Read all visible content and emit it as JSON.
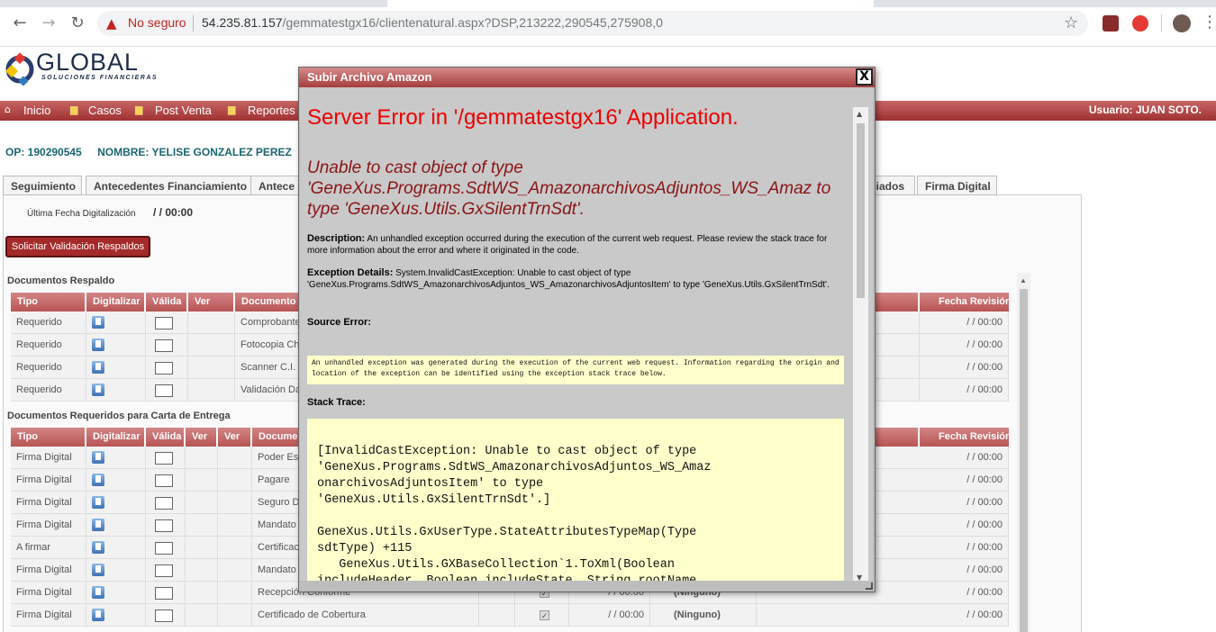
{
  "browser": {
    "security_label": "No seguro",
    "url_host": "54.235.81.157",
    "url_path": "/gemmatestgx16/clientenatural.aspx?DSP,213222,290545,275908,0"
  },
  "logo": {
    "name": "GLOBAL",
    "sub": "SOLUCIONES FINANCIERAS"
  },
  "nav": {
    "items": [
      "Inicio",
      "Casos",
      "Post Venta",
      "Reportes"
    ],
    "user_label": "Usuario:  JUAN SOTO."
  },
  "header": {
    "op": "OP: 190290545",
    "name": "NOMBRE: YELISE GONZALEZ PEREZ"
  },
  "tabs": [
    "Seguimiento",
    "Antecedentes Financiamiento",
    "Antece",
    "ciados",
    "Firma Digital"
  ],
  "digitalizacion": {
    "label": "Última Fecha Digitalización",
    "value": "/ / 00:00"
  },
  "solicitar_button": "Solicitar Validación Respaldos",
  "respaldo": {
    "title": "Documentos Respaldo",
    "headers": [
      "Tipo",
      "Digitalizar",
      "Válida",
      "Ver",
      "Documento",
      "Fecha Revisión"
    ],
    "rows": [
      {
        "tipo": "Requerido",
        "documento": "Comprobante",
        "fecha": "/ / 00:00"
      },
      {
        "tipo": "Requerido",
        "documento": "Fotocopia Ch",
        "fecha": "/ / 00:00"
      },
      {
        "tipo": "Requerido",
        "documento": "Scanner C.I.",
        "fecha": "/ / 00:00"
      },
      {
        "tipo": "Requerido",
        "documento": "Validación Da",
        "fecha": "/ / 00:00"
      }
    ]
  },
  "entrega": {
    "title": "Documentos Requeridos para Carta de Entrega",
    "headers": [
      "Tipo",
      "Digitalizar",
      "Válida",
      "Ver",
      "Ver",
      "Docume",
      "Fecha Revisión"
    ],
    "rows": [
      {
        "tipo": "Firma Digital",
        "documento": "Poder Esp",
        "fecha2": "",
        "estado": "",
        "fecha": "/ / 00:00"
      },
      {
        "tipo": "Firma Digital",
        "documento": "Pagare",
        "fecha2": "",
        "estado": "",
        "fecha": "/ / 00:00"
      },
      {
        "tipo": "Firma Digital",
        "documento": "Seguro D",
        "fecha2": "",
        "estado": "",
        "fecha": "/ / 00:00"
      },
      {
        "tipo": "Firma Digital",
        "documento": "Mandato",
        "fecha2": "",
        "estado": "",
        "fecha": "/ / 00:00"
      },
      {
        "tipo": "A firmar",
        "documento": "Certificac",
        "fecha2": "",
        "estado": "",
        "fecha": "/ / 00:00"
      },
      {
        "tipo": "Firma Digital",
        "documento": "Mandato",
        "fecha2": "",
        "estado": "",
        "fecha": "/ / 00:00"
      },
      {
        "tipo": "Firma Digital",
        "documento": "Recepción Conforme",
        "fecha2": "/ / 00:00",
        "estado": "(Ninguno)",
        "fecha": "/ / 00:00"
      },
      {
        "tipo": "Firma Digital",
        "documento": "Certificado de Cobertura",
        "fecha2": "/ / 00:00",
        "estado": "(Ninguno)",
        "fecha": "/ / 00:00"
      }
    ]
  },
  "modal": {
    "title": "Subir Archivo Amazon",
    "close": "X",
    "error_title": "Server Error in '/gemmatestgx16' Application.",
    "error_message": "Unable to cast object of type 'GeneXus.Programs.SdtWS_AmazonarchivosAdjuntos_WS_Amaz to type 'GeneXus.Utils.GxSilentTrnSdt'.",
    "description_label": "Description:",
    "description_text": "An unhandled exception occurred during the execution of the current web request. Please review the stack trace for more information about the error and where it originated in the code.",
    "exception_label": "Exception Details:",
    "exception_text": "System.InvalidCastException: Unable to cast object of type 'GeneXus.Programs.SdtWS_AmazonarchivosAdjuntos_WS_AmazonarchivosAdjuntosItem' to type 'GeneXus.Utils.GxSilentTrnSdt'.",
    "source_label": "Source Error:",
    "source_text": "An unhandled exception was generated during the execution of the current web request. Information regarding the origin and location of the exception can be identified using the exception stack trace below.",
    "stack_label": "Stack Trace:",
    "stack_text": "[InvalidCastException: Unable to cast object of type\n'GeneXus.Programs.SdtWS_AmazonarchivosAdjuntos_WS_Amaz\nonarchivosAdjuntosItem' to type\n'GeneXus.Utils.GxSilentTrnSdt'.]\n\nGeneXus.Utils.GxUserType.StateAttributesTypeMap(Type\nsdtType) +115\n   GeneXus.Utils.GXBaseCollection`1.ToXml(Boolean\nincludeHeader, Boolean includeState, String rootName"
  }
}
